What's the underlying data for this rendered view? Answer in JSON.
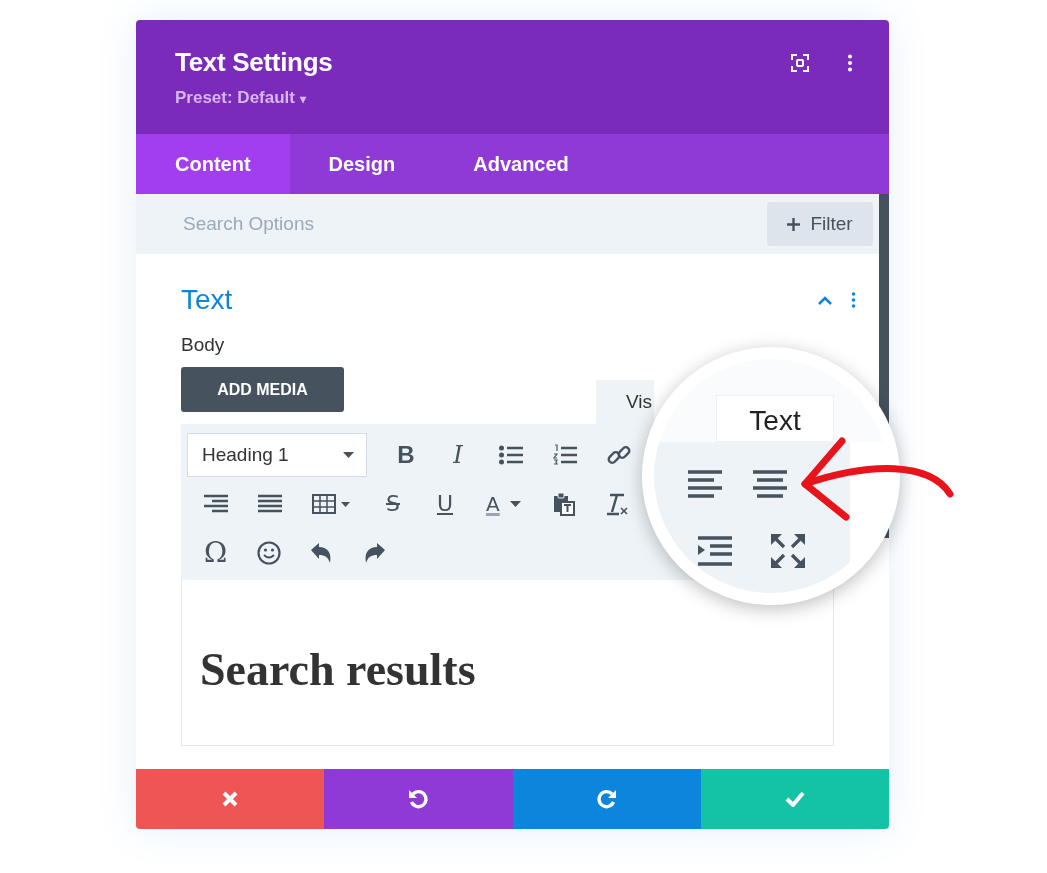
{
  "window": {
    "title": "Text Settings",
    "preset": "Preset: Default",
    "preset_caret": "▾"
  },
  "tabs": [
    {
      "label": "Content",
      "selected": true
    },
    {
      "label": "Design",
      "selected": false
    },
    {
      "label": "Advanced",
      "selected": false
    }
  ],
  "search": {
    "placeholder": "Search Options"
  },
  "filter_button": "Filter",
  "section": {
    "title": "Text",
    "expanded": true
  },
  "body_label": "Body",
  "add_media_button": "ADD MEDIA",
  "editor_tabs": [
    {
      "label": "Vis",
      "selected": true
    },
    {
      "label": "Text",
      "selected": false
    }
  ],
  "format_select": "Heading 1",
  "toolbar_glyphs": [
    "B",
    "I",
    "S",
    "U",
    "A",
    "Ω"
  ],
  "content_heading": "Search results",
  "footer_buttons": [
    {
      "kind": "close",
      "color": "#ef5555"
    },
    {
      "kind": "undo",
      "color": "#8f3ad6"
    },
    {
      "kind": "redo",
      "color": "#0c86dc"
    },
    {
      "kind": "save",
      "color": "#14c2a6"
    }
  ]
}
